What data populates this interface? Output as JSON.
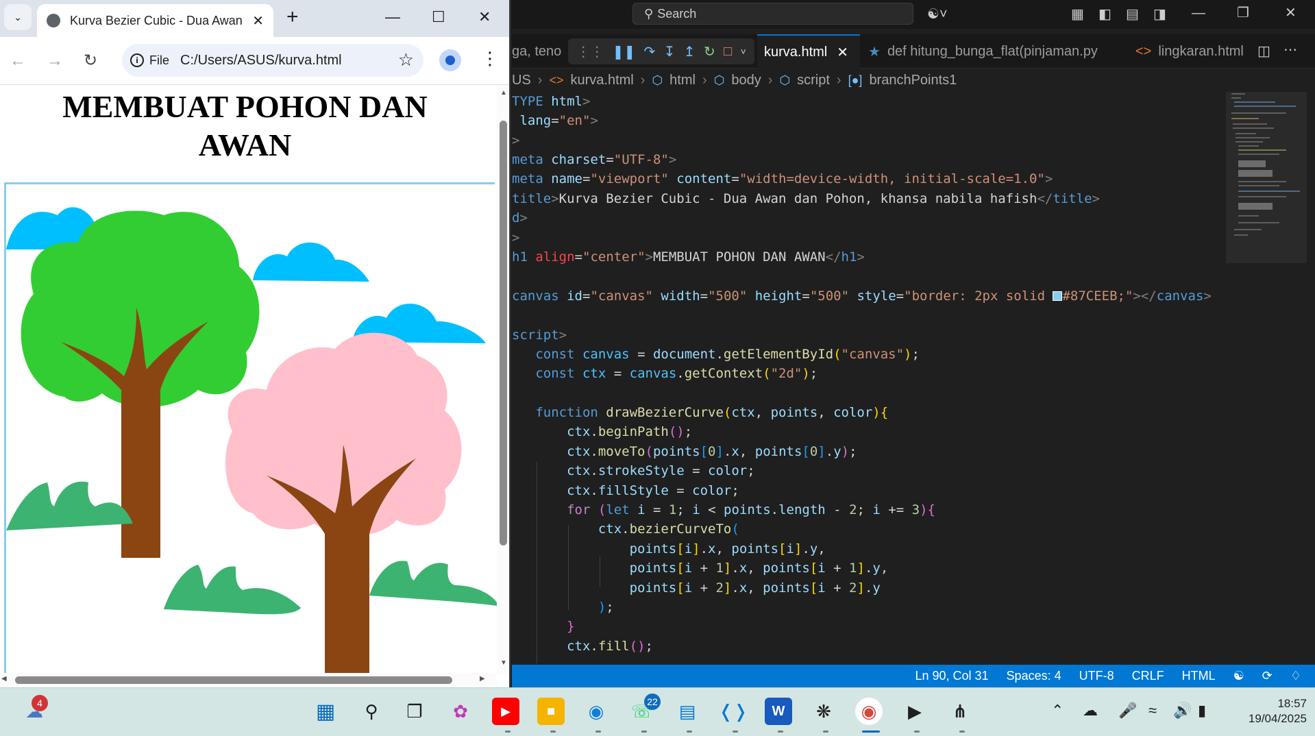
{
  "chrome": {
    "tab_title": "Kurva Bezier Cubic - Dua Awan",
    "url_scheme": "File",
    "url": "C:/Users/ASUS/kurva.html",
    "page_heading": "MEMBUAT POHON DAN AWAN"
  },
  "vscode": {
    "search_placeholder": "Search",
    "tabs": [
      {
        "label": "ga, teno"
      },
      {
        "label": "kurva.html"
      },
      {
        "label": "def hitung_bunga_flat(pinjaman.py"
      },
      {
        "label": "lingkaran.html"
      }
    ],
    "breadcrumb": [
      "US",
      "kurva.html",
      "html",
      "body",
      "script",
      "branchPoints1"
    ],
    "status": {
      "position": "Ln 90, Col 31",
      "spaces": "Spaces: 4",
      "encoding": "UTF-8",
      "eol": "CRLF",
      "language": "HTML"
    }
  },
  "taskbar": {
    "weather_badge": "4",
    "whatsapp_badge": "22",
    "time": "18:57",
    "date": "19/04/2025"
  },
  "colors": {
    "canvas_border": "#87CEEB",
    "cloud": "#00BFFF",
    "tree_green": "#32CD32",
    "tree_pink": "#FFC0CB",
    "trunk": "#8B4513",
    "bush": "#3CB371",
    "status_bar": "#0078D4"
  }
}
